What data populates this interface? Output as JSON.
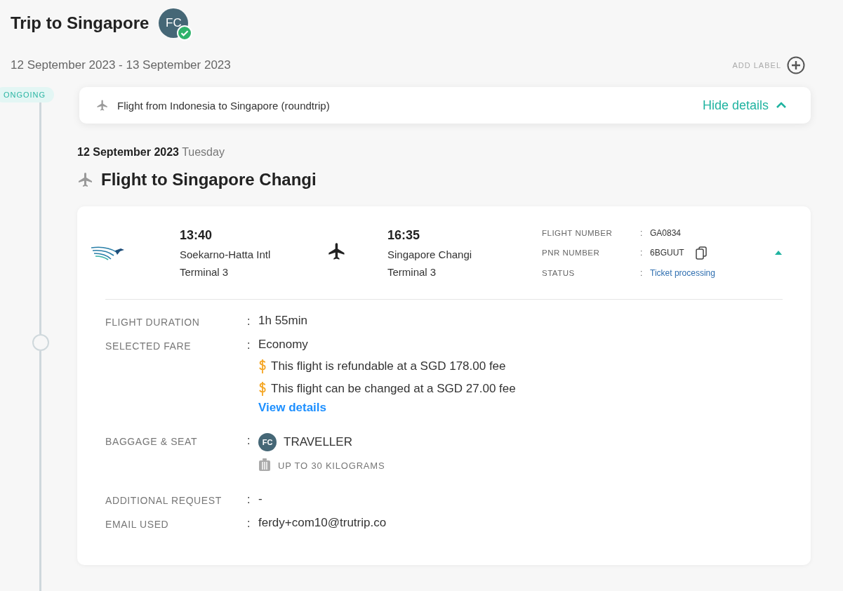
{
  "trip": {
    "title": "Trip to Singapore",
    "avatar": "FC",
    "verified": true,
    "dates": "12 September 2023 - 13 September 2023",
    "add_label": "ADD LABEL"
  },
  "timeline": {
    "status": "ONGOING"
  },
  "summary": {
    "title": "Flight from Indonesia to Singapore (roundtrip)",
    "toggle": "Hide details",
    "expanded": true
  },
  "day": {
    "date": "12 September 2023",
    "weekday": "Tuesday"
  },
  "segment_title": "Flight to Singapore Changi",
  "flight": {
    "expanded": true,
    "depart": {
      "time": "13:40",
      "airport": "Soekarno-Hatta Intl",
      "terminal": "Terminal 3"
    },
    "arrive": {
      "time": "16:35",
      "airport": "Singapore Changi",
      "terminal": "Terminal 3"
    },
    "info": [
      {
        "label": "FLIGHT NUMBER",
        "separator": ":",
        "value": "GA0834",
        "kind": "plain"
      },
      {
        "label": "PNR NUMBER",
        "separator": ":",
        "value": "6BGUUT",
        "kind": "copy"
      },
      {
        "label": "STATUS",
        "separator": ":",
        "value": "Ticket processing",
        "kind": "status"
      }
    ],
    "details": [
      {
        "kind": "text",
        "label": "FLIGHT DURATION",
        "separator": ":",
        "value": "1h 55min"
      },
      {
        "kind": "fare",
        "label": "SELECTED FARE",
        "separator": ":",
        "value": "Economy",
        "notes": [
          "This flight is refundable at a SGD 178.00 fee",
          "This flight can be changed at a SGD 27.00 fee"
        ],
        "link": "View details"
      },
      {
        "kind": "traveller",
        "label": "BAGGAGE & SEAT",
        "separator": ":",
        "avatar": "FC",
        "value": "TRAVELLER",
        "baggage": "UP TO 30 KILOGRAMS"
      },
      {
        "kind": "text",
        "label": "ADDITIONAL REQUEST",
        "separator": ":",
        "value": "-"
      },
      {
        "kind": "text",
        "label": "EMAIL USED",
        "separator": ":",
        "value": "ferdy+com10@trutrip.co"
      }
    ]
  }
}
